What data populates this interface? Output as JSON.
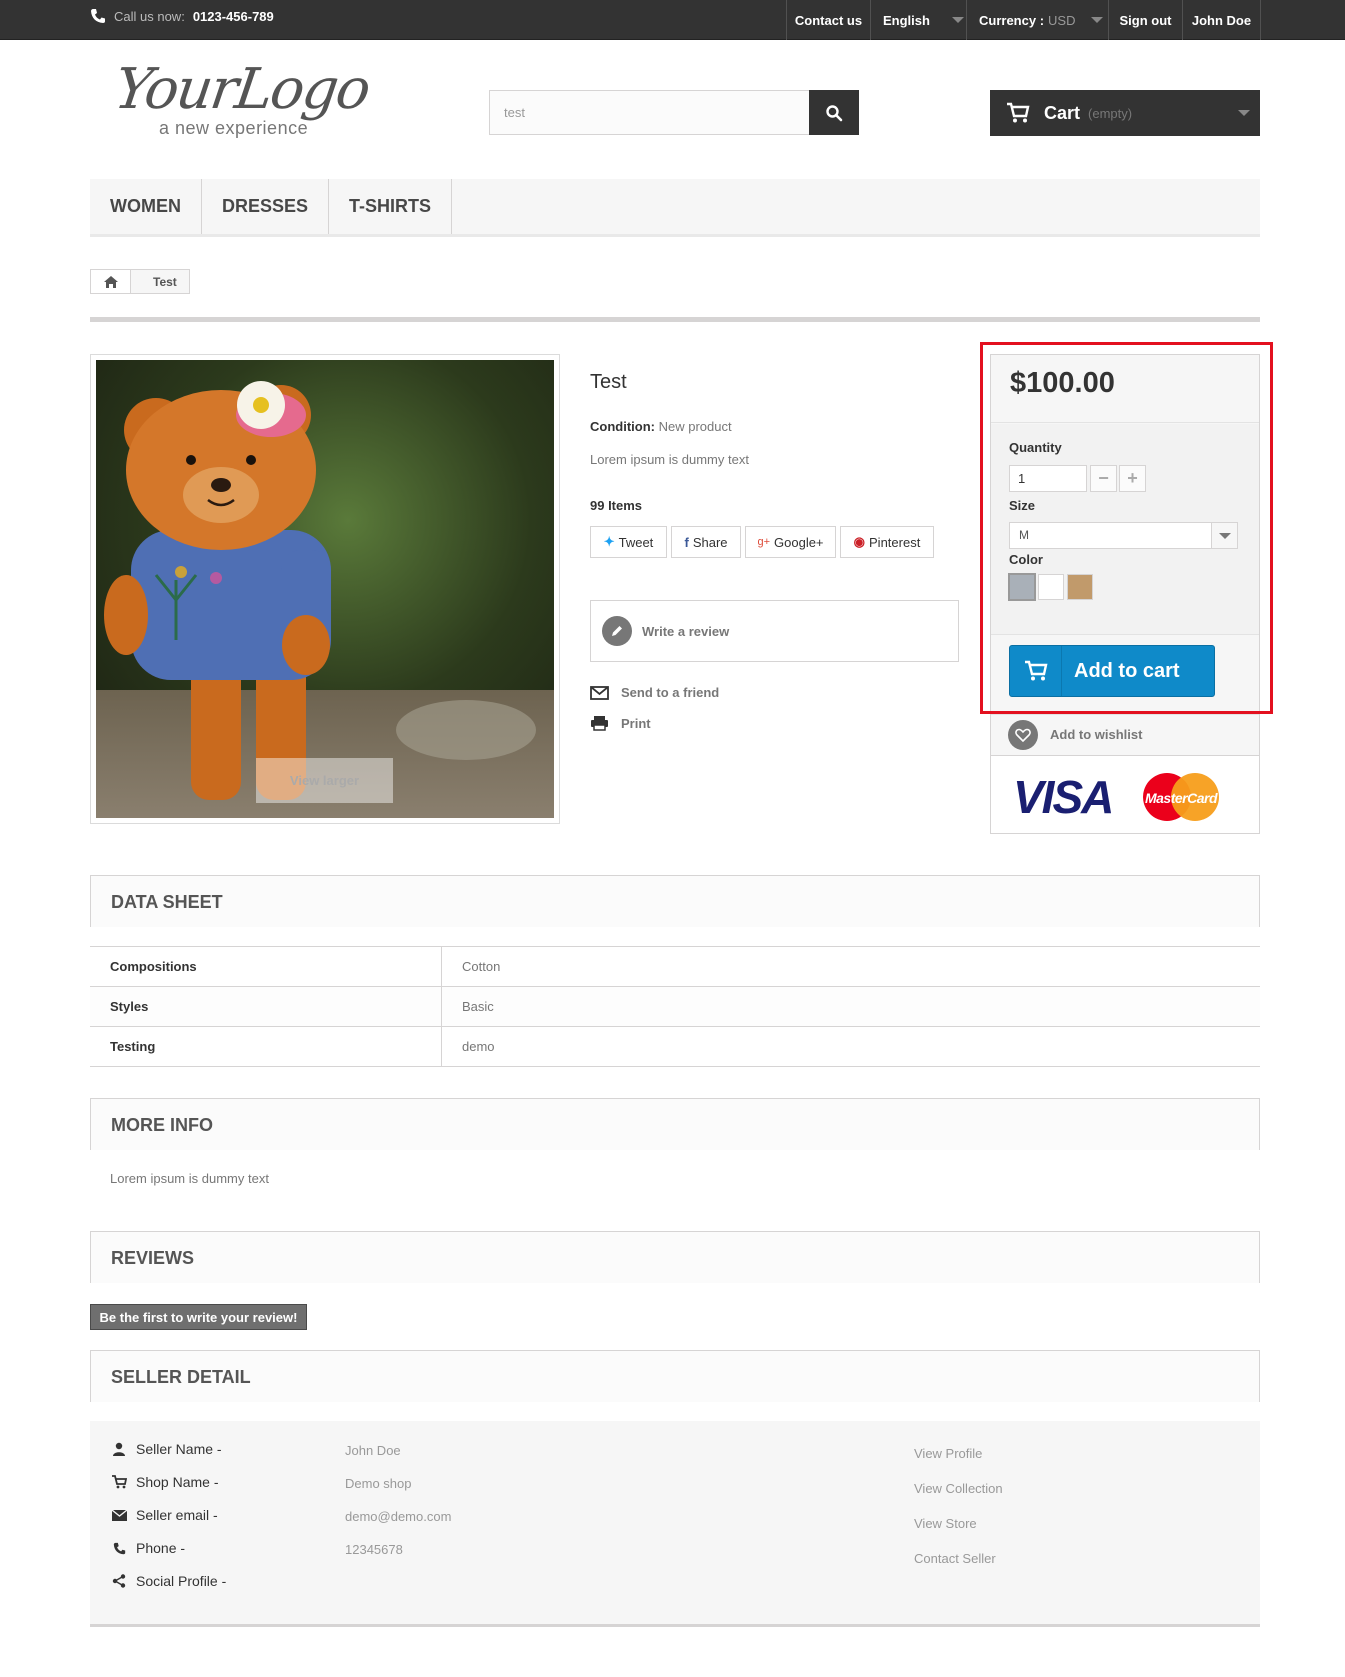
{
  "topbar": {
    "call_label": "Call us now:",
    "phone": "0123-456-789",
    "contact": "Contact us",
    "language": "English",
    "currency_label": "Currency :",
    "currency_value": "USD",
    "signout": "Sign out",
    "user": "John Doe"
  },
  "logo": {
    "script": "YourLogo",
    "tagline": "a new experience"
  },
  "search": {
    "value": "test"
  },
  "cart": {
    "label": "Cart",
    "status": "(empty)"
  },
  "menu": [
    "WOMEN",
    "DRESSES",
    "T-SHIRTS"
  ],
  "breadcrumb": {
    "current": "Test"
  },
  "product": {
    "view_larger": "View larger",
    "title": "Test",
    "condition_label": "Condition:",
    "condition_value": "New product",
    "description": "Lorem ipsum is dummy text",
    "stock": "99 Items",
    "social": [
      "Tweet",
      "Share",
      "Google+",
      "Pinterest"
    ],
    "write_review": "Write a review",
    "send_friend": "Send to a friend",
    "print": "Print"
  },
  "buy": {
    "price": "$100.00",
    "quantity_label": "Quantity",
    "quantity_value": "1",
    "size_label": "Size",
    "size_value": "M",
    "color_label": "Color",
    "colors": [
      "#a9b0b8",
      "#ffffff",
      "#c19a6b"
    ],
    "add_to_cart": "Add to cart",
    "wishlist": "Add to wishlist",
    "visa": "VISA",
    "mastercard": "MasterCard"
  },
  "datasheet": {
    "title": "DATA SHEET",
    "rows": [
      {
        "key": "Compositions",
        "value": "Cotton"
      },
      {
        "key": "Styles",
        "value": "Basic"
      },
      {
        "key": "Testing",
        "value": "demo"
      }
    ]
  },
  "moreinfo": {
    "title": "MORE INFO",
    "text": "Lorem ipsum is dummy text"
  },
  "reviews": {
    "title": "REVIEWS",
    "button": "Be the first to write your review!"
  },
  "seller": {
    "title": "SELLER DETAIL",
    "rows": [
      {
        "label": "Seller Name -",
        "value": "John Doe"
      },
      {
        "label": "Shop Name -",
        "value": "Demo shop"
      },
      {
        "label": "Seller email -",
        "value": "demo@demo.com"
      },
      {
        "label": "Phone -",
        "value": "12345678"
      },
      {
        "label": "Social Profile -",
        "value": ""
      }
    ],
    "links": [
      "View Profile",
      "View Collection",
      "View Store",
      "Contact Seller"
    ]
  }
}
